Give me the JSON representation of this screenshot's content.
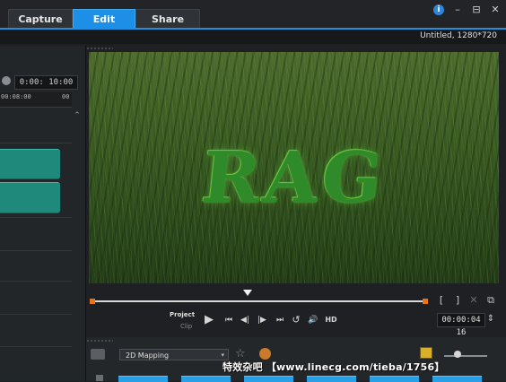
{
  "tabs": [
    {
      "label": "Capture"
    },
    {
      "label": "Edit"
    },
    {
      "label": "Share"
    }
  ],
  "window_controls": {
    "help": "i",
    "minimize": "–",
    "maximize": "⊟",
    "close": "✕"
  },
  "project_info": "Untitled, 1280*720",
  "timeline": {
    "timecode": "0:00: 10:00",
    "ruler_labels": [
      "00:08:00",
      "00"
    ],
    "scroll_up": "⌃"
  },
  "preview": {
    "overlay_title": "RAG",
    "trim_start": "[",
    "trim_end": "]",
    "mini_buttons": [
      "✕",
      "⧉"
    ]
  },
  "transport": {
    "project_label": "Project",
    "clip_label": "Clip",
    "buttons": [
      "▶",
      "⏮",
      "◀|",
      "|▶",
      "⏭",
      "↺",
      "🔊",
      "HD"
    ],
    "timecode_out": "00:00:04 16",
    "timecode_spinner": "⇕"
  },
  "library": {
    "filter_select": "2D Mapping",
    "caret": "▾",
    "star_icon": "☆",
    "watermark": "特效杂吧 【www.linecg.com/tieba/1756】"
  },
  "colors": {
    "accent": "#1e8fe6",
    "clip": "#1f8a7c",
    "trim": "#e8741a"
  }
}
